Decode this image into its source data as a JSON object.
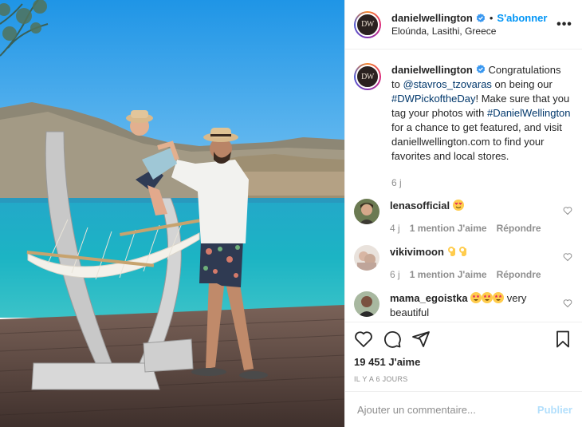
{
  "post": {
    "image_description_icon": "photo",
    "author": {
      "username": "danielwellington",
      "avatar_text": "DW",
      "location": "Eloúnda, Lasithi, Greece",
      "follow_label": "S'abonner",
      "separator": "•",
      "more_label": "•••"
    },
    "caption": {
      "username": "danielwellington",
      "text_1": " Congratulations to ",
      "mention": "@stavros_tzovaras",
      "text_2": " on being our ",
      "hashtag_1": "#DWPickoftheDay",
      "text_3": "! Make sure that you tag your photos with ",
      "hashtag_2": "#DanielWellington",
      "text_4": " for a chance to get featured, and visit daniellwellington.com to find your favorites and local stores.",
      "time": "6 j"
    },
    "comments": [
      {
        "username": "lenasofficial",
        "emoji_icons": [
          "heart-eyes-emoji"
        ],
        "text": "",
        "time": "4 j",
        "likes": "1 mention J'aime",
        "reply": "Répondre"
      },
      {
        "username": "vikivimoon",
        "emoji_icons": [
          "ok-hand-emoji",
          "ok-hand-emoji"
        ],
        "text": "",
        "time": "6 j",
        "likes": "1 mention J'aime",
        "reply": "Répondre"
      },
      {
        "username": "mama_egoistka",
        "emoji_icons": [
          "star-struck-emoji",
          "star-struck-emoji",
          "star-struck-emoji"
        ],
        "text": " very beautiful"
      }
    ],
    "likes_count": "19 451 J'aime",
    "posted_ago": "IL Y A 6 JOURS",
    "add_comment_placeholder": "Ajouter un commentaire...",
    "publish_label": "Publier"
  },
  "colors": {
    "accent": "#0095f6",
    "link": "#00376b",
    "muted": "#8e8e8e",
    "publish_disabled": "#b2dffc"
  }
}
